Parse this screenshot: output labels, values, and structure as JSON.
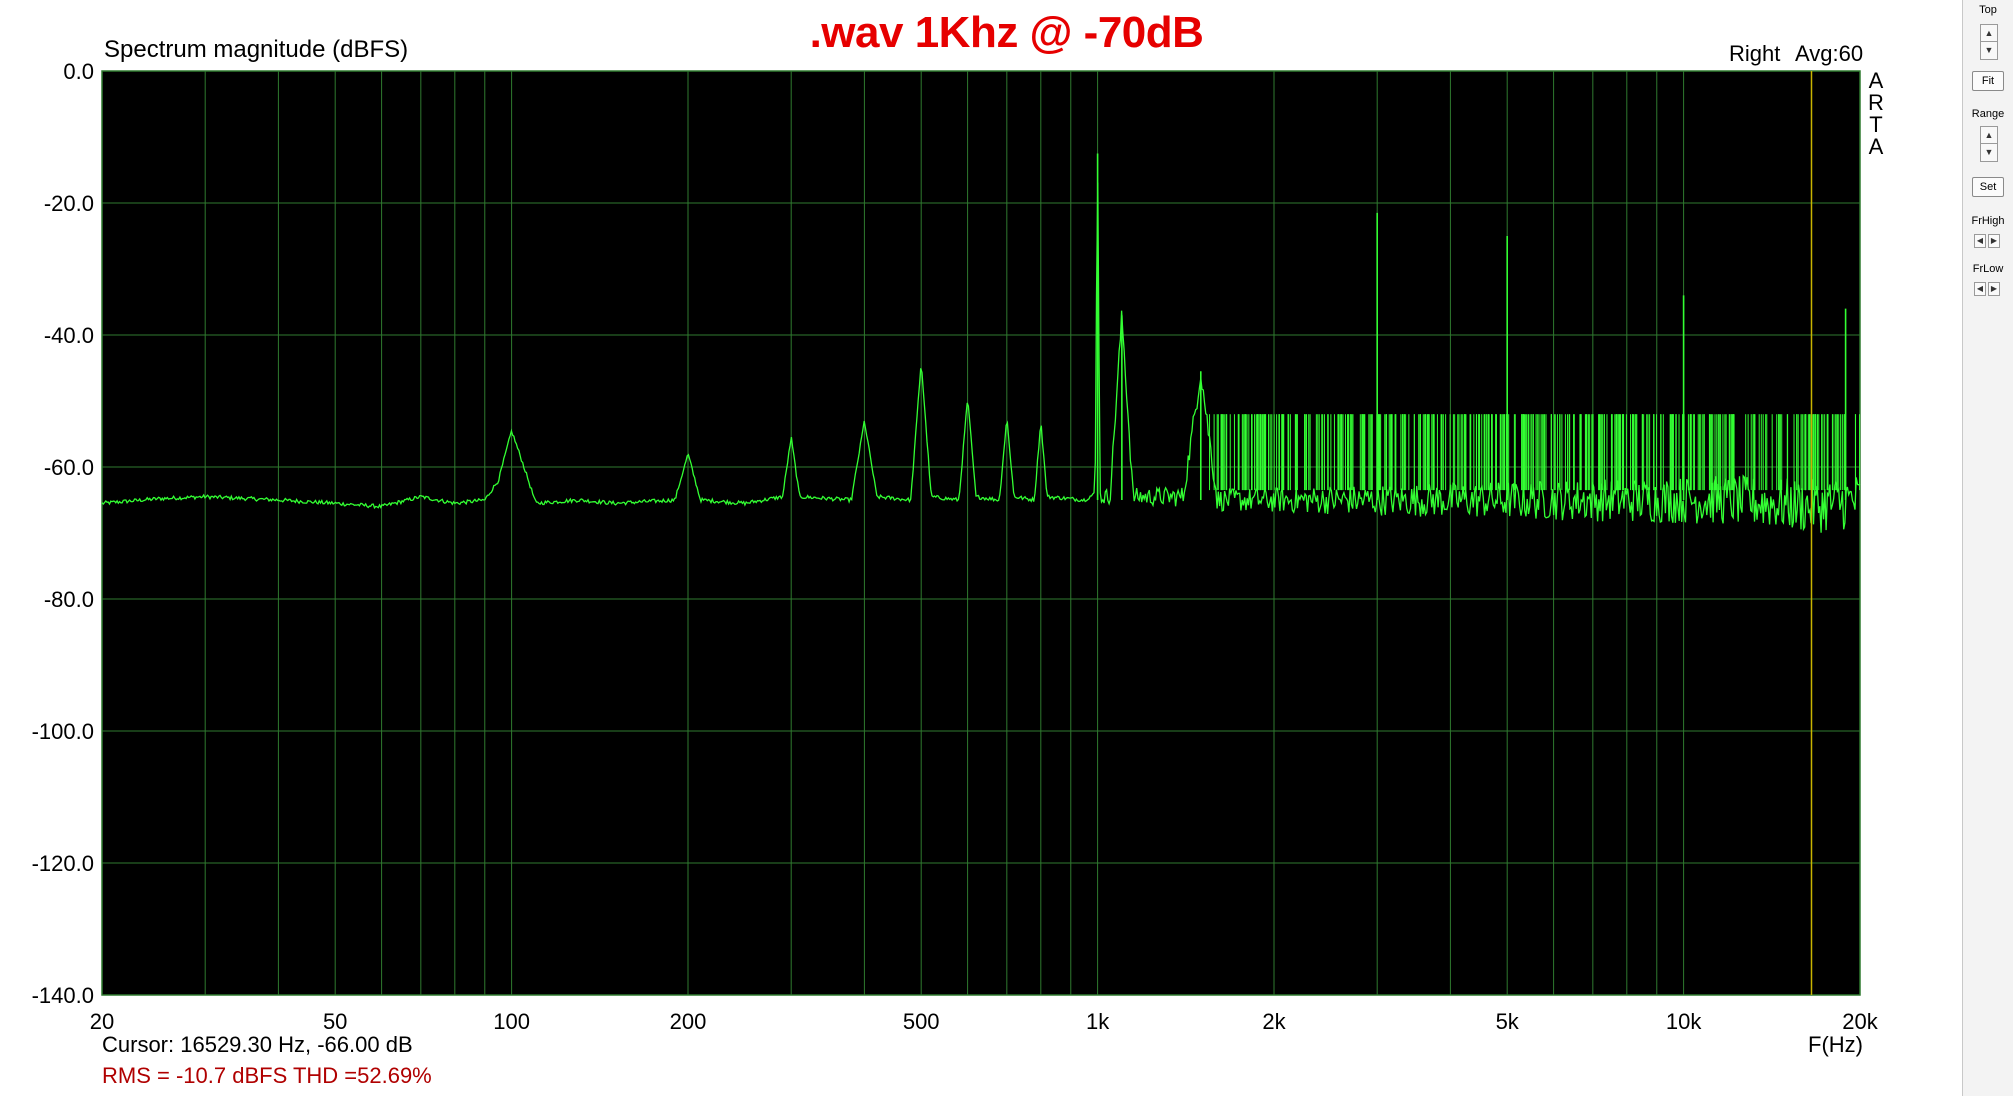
{
  "overlay_title": ".wav 1Khz @ -70dB",
  "plot": {
    "header_left": "Spectrum magnitude (dBFS)",
    "header_right_channel": "Right",
    "header_right_avg": "Avg:60",
    "vertical_label": [
      "A",
      "R",
      "T",
      "A"
    ],
    "cursor_readout": "Cursor: 16529.30 Hz, -66.00 dB",
    "measurement_readout": "RMS =  -10.7 dBFS  THD =52.69%",
    "x_axis_title": "F(Hz)",
    "background_color": "#000000",
    "trace_color": "#33ff33",
    "grid_color": "#2f7a2f",
    "cursor_line_color": "#c8b400"
  },
  "chart_data": {
    "type": "line",
    "ylabel": "Spectrum magnitude (dBFS)",
    "xlabel": "F(Hz)",
    "x_scale": "log",
    "xlim": [
      20,
      20000
    ],
    "ylim": [
      -140,
      0
    ],
    "y_ticks": [
      0,
      -20,
      -40,
      -60,
      -80,
      -100,
      -120,
      -140
    ],
    "y_tick_labels": [
      "0.0",
      "-20.0",
      "-40.0",
      "-60.0",
      "-80.0",
      "-100.0",
      "-120.0",
      "-140.0"
    ],
    "x_ticks": [
      20,
      50,
      100,
      200,
      500,
      1000,
      2000,
      5000,
      10000,
      20000
    ],
    "x_tick_labels": [
      "20",
      "50",
      "100",
      "200",
      "500",
      "1k",
      "2k",
      "5k",
      "10k",
      "20k"
    ],
    "grid": true,
    "cursor_x": 16529.3,
    "noise_floor_db": -65,
    "series": [
      {
        "x": [
          20,
          25,
          30,
          40,
          50,
          60,
          70,
          80,
          90,
          95,
          100,
          105,
          110,
          130,
          150,
          190,
          200,
          210,
          250,
          290,
          300,
          310,
          380,
          400,
          420,
          480,
          500,
          520,
          580,
          600,
          620,
          680,
          700,
          720,
          780,
          800,
          820,
          950,
          990,
          1000,
          1010,
          1050,
          1100,
          1150,
          1400,
          1500,
          1600,
          2000,
          3000,
          5000,
          8000,
          12000,
          16529,
          20000
        ],
        "y": [
          -65.5,
          -64.8,
          -64.5,
          -65,
          -65.5,
          -66,
          -64.5,
          -65.5,
          -65,
          -62,
          -54.5,
          -60,
          -65.5,
          -65,
          -65.5,
          -65,
          -58,
          -65,
          -65.5,
          -64.5,
          -55.5,
          -64.5,
          -65,
          -53,
          -64.5,
          -65,
          -44,
          -64.5,
          -65,
          -49.5,
          -64.5,
          -65,
          -52.5,
          -64.5,
          -65,
          -53,
          -64.5,
          -65,
          -64,
          -12.5,
          -64.5,
          -64.5,
          -37,
          -64.5,
          -64.5,
          -45.5,
          -65,
          -65,
          -65,
          -65,
          -65,
          -65,
          -66,
          -65
        ]
      }
    ],
    "spikes": [
      {
        "x": 1000,
        "y": -12.5
      },
      {
        "x": 1100,
        "y": -37
      },
      {
        "x": 1500,
        "y": -45.5
      },
      {
        "x": 3000,
        "y": -21.5
      },
      {
        "x": 5000,
        "y": -25
      },
      {
        "x": 10000,
        "y": -34
      },
      {
        "x": 18900,
        "y": -36
      }
    ]
  },
  "control_panel": {
    "top_label": "Top",
    "fit_label": "Fit",
    "range_label": "Range",
    "set_label": "Set",
    "frhigh_label": "FrHigh",
    "frlow_label": "FrLow"
  }
}
